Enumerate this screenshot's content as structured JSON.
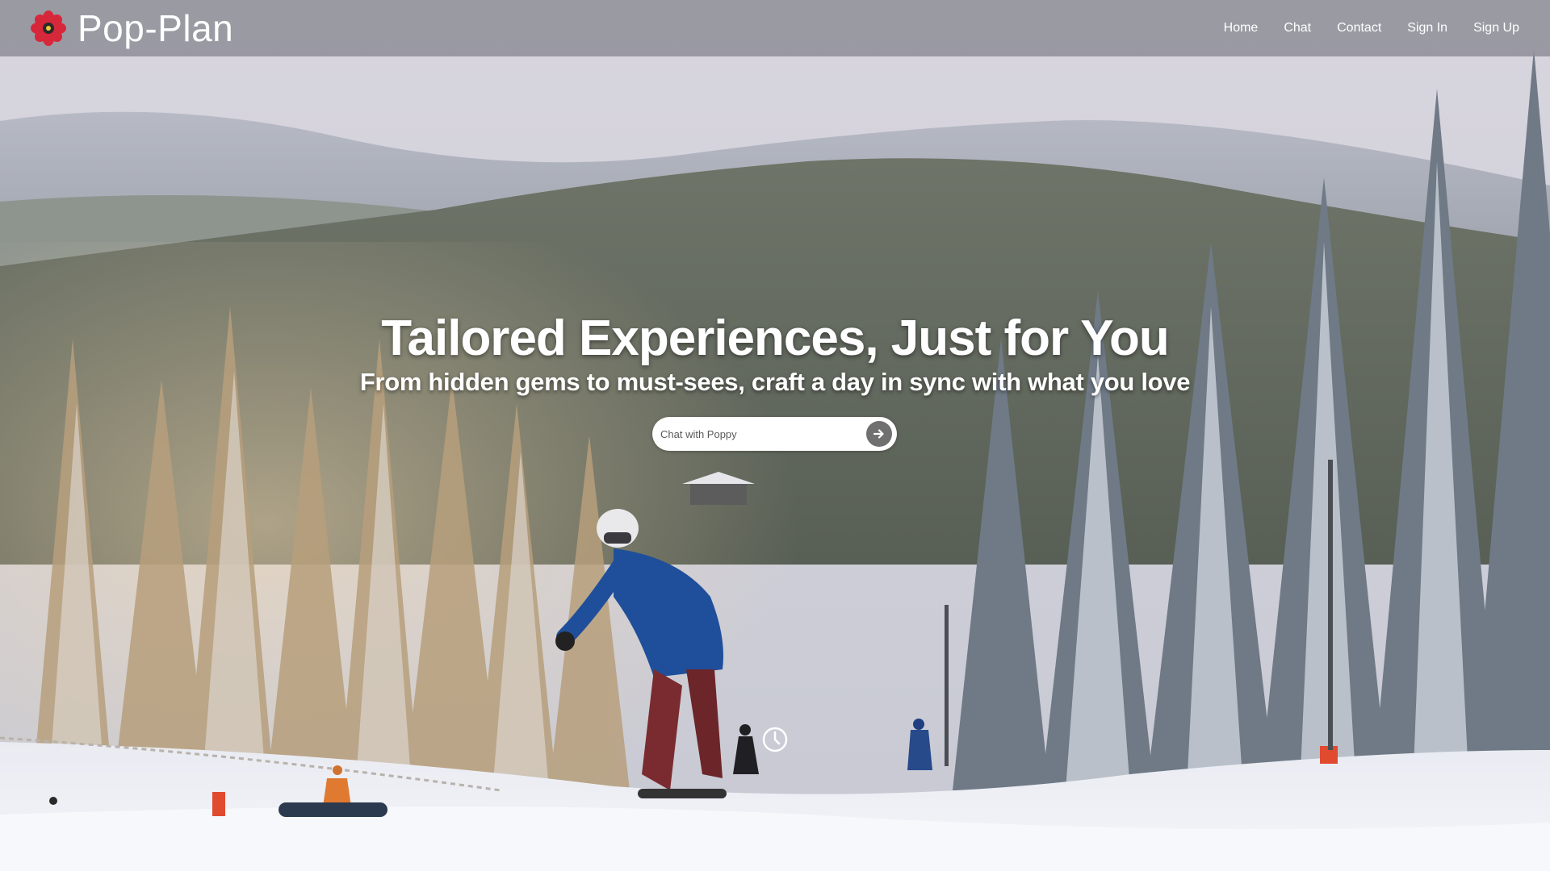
{
  "brand": {
    "name": "Pop-Plan",
    "logo_icon": "poppy-flower-icon"
  },
  "nav": {
    "items": [
      {
        "label": "Home"
      },
      {
        "label": "Chat"
      },
      {
        "label": "Contact"
      },
      {
        "label": "Sign In"
      },
      {
        "label": "Sign Up"
      }
    ]
  },
  "hero": {
    "title": "Tailored Experiences, Just for You",
    "subtitle": "From hidden gems to must-sees, craft a day in sync with what you love",
    "background": "snowy-forest-ski-slope-video"
  },
  "chat": {
    "placeholder": "Chat with Poppy",
    "send_icon": "arrow-right-icon"
  },
  "loader_icon": "loading-clock-icon",
  "colors": {
    "nav_bg": "#8c8c96",
    "text": "#ffffff",
    "send_button": "#707070",
    "logo_petals": "#d6283a"
  }
}
